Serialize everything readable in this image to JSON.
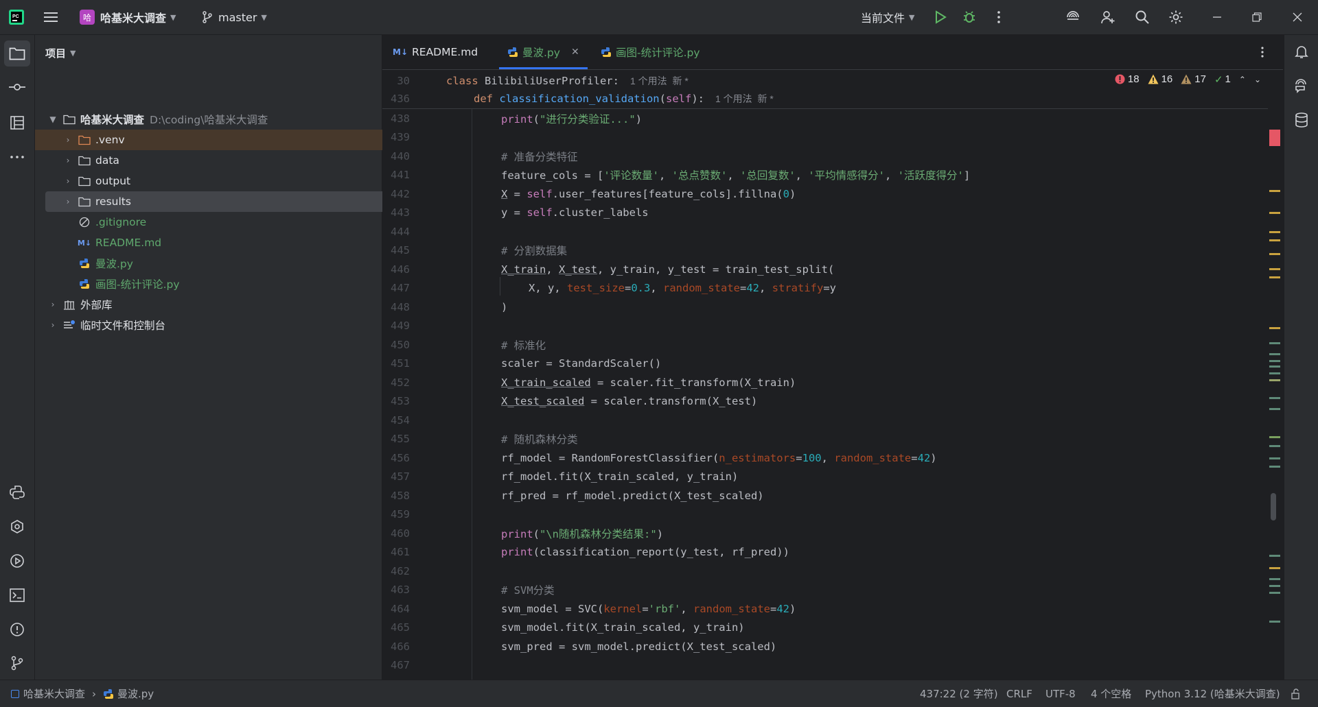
{
  "titlebar": {
    "project_badge": "哈",
    "project_name": "哈基米大调查",
    "branch": "master",
    "run_config": "当前文件"
  },
  "project_panel": {
    "title": "项目",
    "root": {
      "name": "哈基米大调查",
      "path": "D:\\coding\\哈基米大调查"
    },
    "items": [
      {
        "label": ".venv"
      },
      {
        "label": "data"
      },
      {
        "label": "output"
      },
      {
        "label": "results"
      },
      {
        "label": ".gitignore"
      },
      {
        "label": "README.md"
      },
      {
        "label": "曼波.py"
      },
      {
        "label": "画图-统计评论.py"
      },
      {
        "label": "外部库"
      },
      {
        "label": "临时文件和控制台"
      }
    ]
  },
  "tabs": [
    {
      "label": "README.md"
    },
    {
      "label": "曼波.py"
    },
    {
      "label": "画图-统计评论.py"
    }
  ],
  "inspections": {
    "errors": "18",
    "warnings": "16",
    "weak_warnings": "17",
    "typos": "1"
  },
  "sticky": [
    {
      "ln": "30",
      "code": "class BilibiliUserProfiler:",
      "hint": "1 个用法  新 *"
    },
    {
      "ln": "436",
      "code": "def classification_validation(self):",
      "hint": "1 个用法  新 *"
    }
  ],
  "lines": {
    "l438": "438",
    "l439": "439",
    "l440": "440",
    "l441": "441",
    "l442": "442",
    "l443": "443",
    "l444": "444",
    "l445": "445",
    "l446": "446",
    "l447": "447",
    "l448": "448",
    "l449": "449",
    "l450": "450",
    "l451": "451",
    "l452": "452",
    "l453": "453",
    "l454": "454",
    "l455": "455",
    "l456": "456",
    "l457": "457",
    "l458": "458",
    "l459": "459",
    "l460": "460",
    "l461": "461",
    "l462": "462",
    "l463": "463",
    "l464": "464",
    "l465": "465",
    "l466": "466",
    "l467": "467"
  },
  "code": {
    "c438s": "\"进行分类验证...\"",
    "c440": "# 准备分类特征",
    "c441a": "'评论数量'",
    "c441b": "'总点赞数'",
    "c441c": "'总回复数'",
    "c441d": "'平均情感得分'",
    "c441e": "'活跃度得分'",
    "c442n": "0",
    "c445": "# 分割数据集",
    "c447a": "0.3",
    "c447b": "42",
    "c450": "# 标准化",
    "c455": "# 随机森林分类",
    "c456a": "100",
    "c456b": "42",
    "c460s": "\"\\n随机森林分类结果:\"",
    "c463": "# SVM分类",
    "c464s": "'rbf'",
    "c464n": "42"
  },
  "breadcrumb": {
    "project": "哈基米大调查",
    "file": "曼波.py"
  },
  "status": {
    "position": "437:22 (2 字符)",
    "line_sep": "CRLF",
    "encoding": "UTF-8",
    "indent": "4 个空格",
    "interpreter": "Python 3.12 (哈基米大调查)"
  },
  "colors": {
    "accent": "#3574f0",
    "keyword": "#cf8e6d",
    "string": "#6aab73",
    "number": "#2aacb8",
    "function": "#56a8f5",
    "comment": "#7a7e85"
  }
}
